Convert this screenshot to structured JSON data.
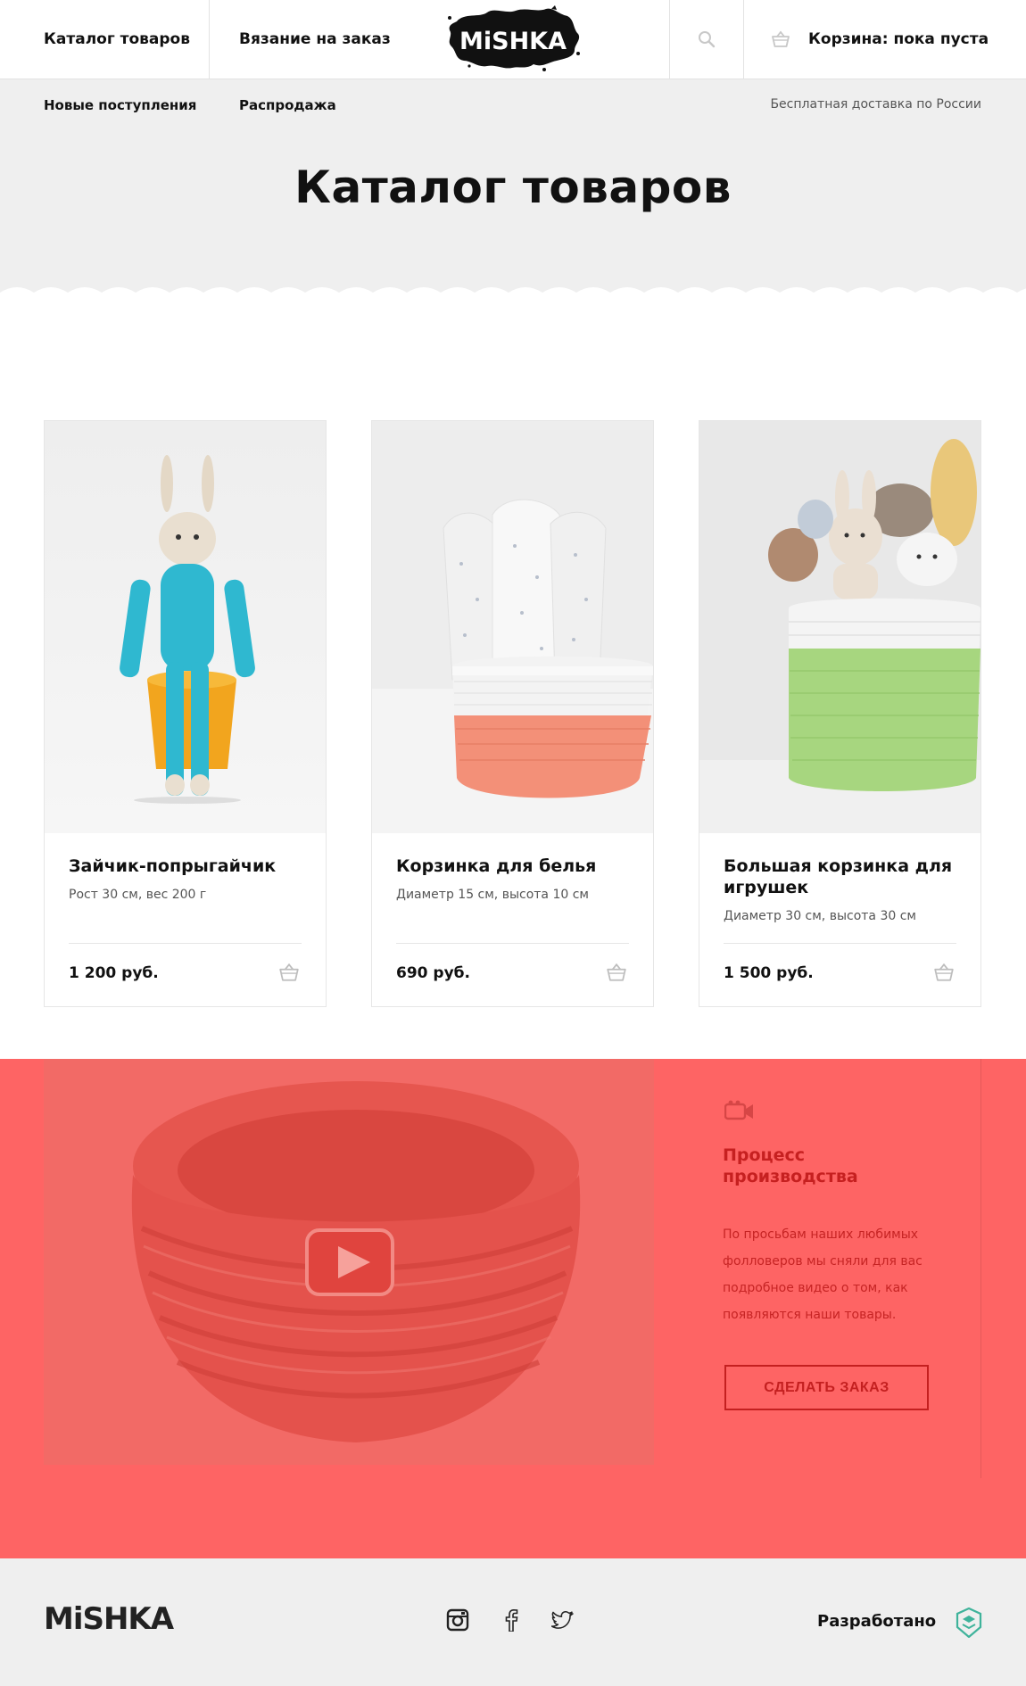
{
  "header": {
    "nav": [
      "Каталог товаров",
      "Вязание на заказ"
    ],
    "logo_text": "MiSHKA",
    "search_icon": "search-icon",
    "cart_icon": "basket-icon",
    "cart_label": "Корзина: пока пуста"
  },
  "subnav": {
    "links": [
      "Новые поступления",
      "Распродажа"
    ],
    "delivery_note": "Бесплатная доставка по России"
  },
  "page_title": "Каталог товаров",
  "products": [
    {
      "title": "Зайчик-попрыгайчик",
      "desc": "Рост 30 см, вес 200 г",
      "price": "1 200 руб.",
      "cart_icon": "basket-icon"
    },
    {
      "title": "Корзинка для белья",
      "desc": "Диаметр 15 см, высота 10 см",
      "price": "690 руб.",
      "cart_icon": "basket-icon"
    },
    {
      "title": "Большая корзинка для игрушек",
      "desc": "Диаметр 30 см, высота 30 см",
      "price": "1 500 руб.",
      "cart_icon": "basket-icon"
    }
  ],
  "video": {
    "title": "Процесс производства",
    "text": "По просьбам наших любимых фолловеров мы сняли для вас подробное видео о том, как появляются наши товары.",
    "button": "СДЕЛАТЬ ЗАКАЗ",
    "play_icon": "youtube-play-icon",
    "camera_icon": "video-camera-icon"
  },
  "footer": {
    "logo_text": "MiSHKA",
    "social": [
      "instagram-icon",
      "facebook-icon",
      "twitter-icon"
    ],
    "developer_label": "Разработано",
    "developer_icon": "htmlacademy-logo-icon"
  },
  "colors": {
    "accent": "#fe6464",
    "accent_dark": "#c42020",
    "background_gray": "#efefef",
    "text": "#111111"
  }
}
